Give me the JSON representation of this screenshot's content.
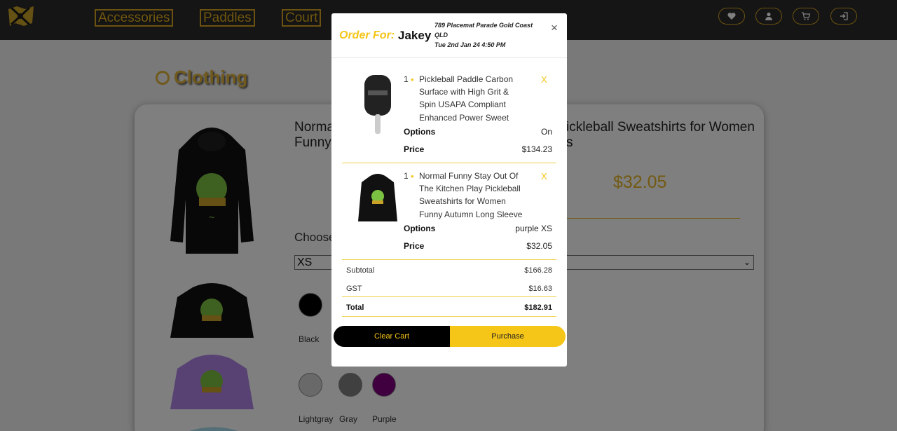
{
  "header": {
    "nav": [
      "Accessories",
      "Paddles",
      "Court"
    ],
    "icons": [
      "heart-icon",
      "user-icon",
      "cart-icon",
      "login-icon"
    ]
  },
  "page": {
    "section_title": "Clothing",
    "product_title_left": "Norma Funny",
    "product_title_right": "ickleball Sweatshirts for Women s",
    "price": "$32.05",
    "choose_label": "Choose",
    "size_selected": "XS",
    "swatches": [
      {
        "label": "Black",
        "color": "#000000"
      },
      {
        "label": "Lightgray",
        "color": "#d3d3d3"
      },
      {
        "label": "Gray",
        "color": "#808080"
      },
      {
        "label": "Purple",
        "color": "#800080"
      }
    ]
  },
  "modal": {
    "order_label": "Order For:",
    "customer_name": "Jakey",
    "address": "789 Placemat Parade Gold Coast QLD",
    "datetime": "Tue 2nd Jan 24 4:50 PM",
    "close_glyph": "×",
    "items": [
      {
        "qty": "1",
        "name": "Pickleball Paddle Carbon Surface with High Grit & Spin USAPA Compliant Enhanced Power Sweet",
        "options_label": "Options",
        "options_value": "On",
        "price_label": "Price",
        "price_value": "$134.23",
        "remove": "X"
      },
      {
        "qty": "1",
        "name": "Normal Funny Stay Out Of The Kitchen Play Pickleball Sweatshirts for Women Funny Autumn Long Sleeve",
        "options_label": "Options",
        "options_value": "purple XS",
        "price_label": "Price",
        "price_value": "$32.05",
        "remove": "X"
      }
    ],
    "summary": {
      "subtotal_label": "Subtotal",
      "subtotal_value": "$166.28",
      "gst_label": "GST",
      "gst_value": "$16.63",
      "total_label": "Total",
      "total_value": "$182.91"
    },
    "clear_label": "Clear Cart",
    "purchase_label": "Purchase"
  },
  "colors": {
    "accent": "#f5c518",
    "header_bg": "#2b2b2b",
    "nav_border": "#d9a521"
  }
}
